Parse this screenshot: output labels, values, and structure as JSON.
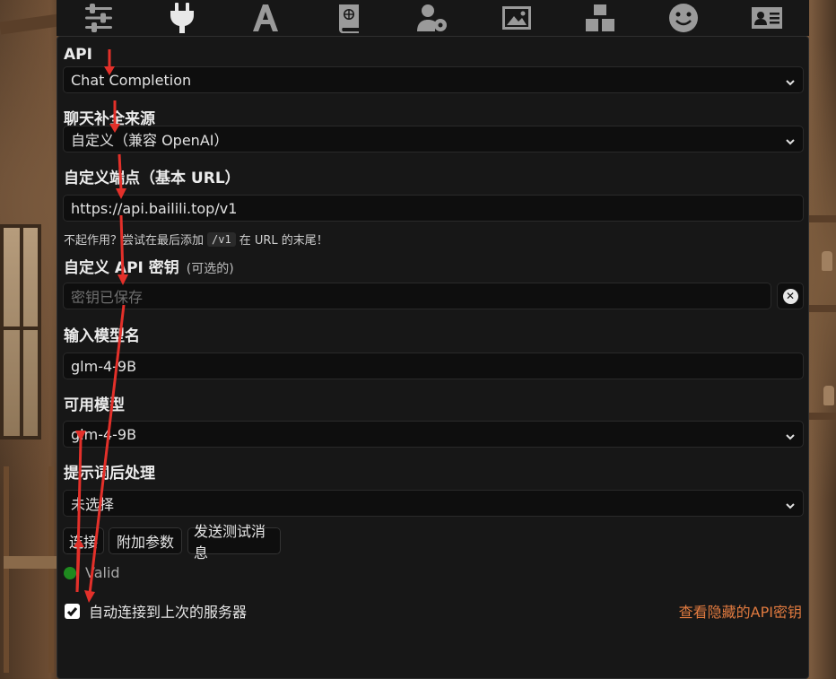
{
  "top_nav": {
    "icons": [
      "sliders-icon",
      "plug-icon",
      "font-icon",
      "book-icon",
      "user-gear-icon",
      "image-icon",
      "cubes-icon",
      "smile-icon",
      "id-card-icon"
    ],
    "active": "plug-icon"
  },
  "api": {
    "label": "API",
    "value": "Chat Completion"
  },
  "chat_source": {
    "label": "聊天补全来源",
    "value": "自定义（兼容 OpenAI）"
  },
  "endpoint": {
    "label": "自定义端点（基本 URL）",
    "value": "https://api.bailili.top/v1",
    "hint_before": "不起作用？尝试在最后添加",
    "hint_code": "/v1",
    "hint_after": "在 URL 的末尾！"
  },
  "api_key": {
    "label": "自定义 API 密钥",
    "optional": "(可选的)",
    "placeholder": "密钥已保存"
  },
  "model_input": {
    "label": "输入模型名",
    "value": "glm-4-9B"
  },
  "available_models": {
    "label": "可用模型",
    "value": "glm-4-9B"
  },
  "post_processing": {
    "label": "提示词后处理",
    "value": "未选择"
  },
  "buttons": {
    "connect": "连接",
    "extra_params": "附加参数",
    "send_test": "发送测试消息"
  },
  "status": {
    "text": "Valid",
    "color": "#1f8a1f"
  },
  "auto_connect": {
    "label": "自动连接到上次的服务器",
    "checked": true
  },
  "reveal_keys": {
    "label": "查看隐藏的API密钥",
    "color": "#e07a3f"
  }
}
